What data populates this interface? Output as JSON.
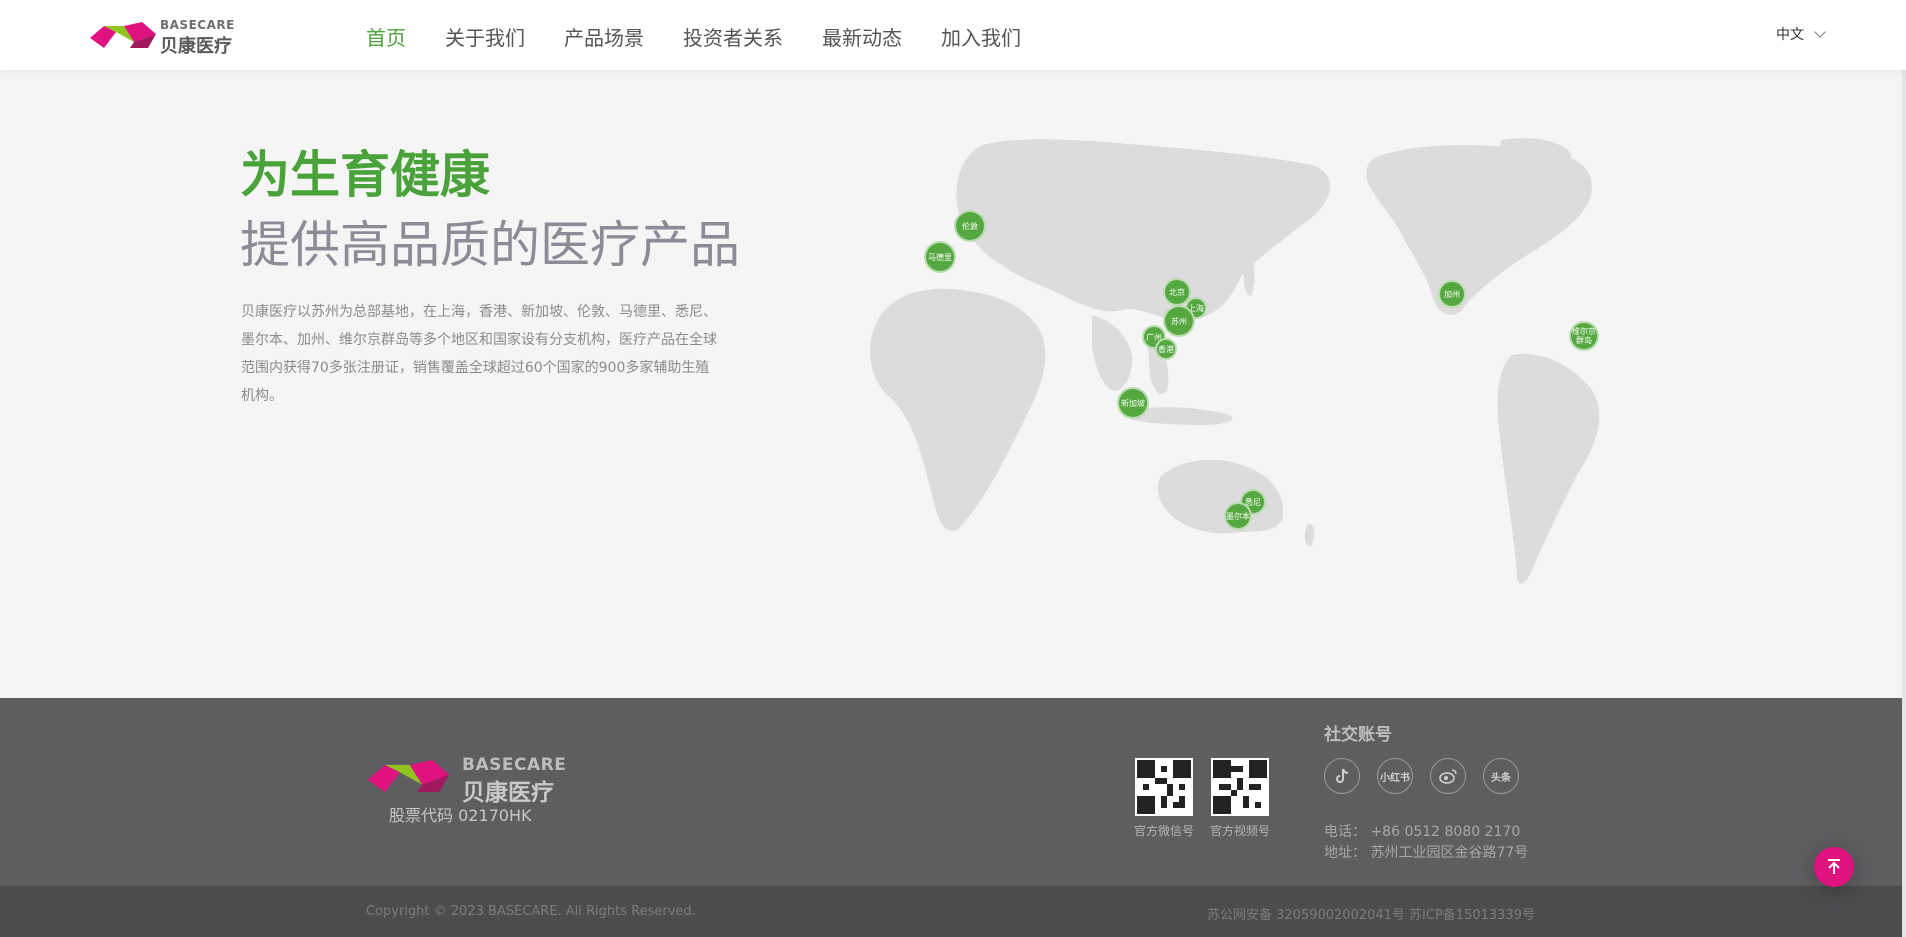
{
  "header": {
    "logo_en": "BASECARE",
    "logo_cn": "贝康医疗",
    "nav": [
      "首页",
      "关于我们",
      "产品场景",
      "投资者关系",
      "最新动态",
      "加入我们"
    ],
    "lang": "中文"
  },
  "hero": {
    "title1": "为生育健康",
    "title2": "提供高品质的医疗产品",
    "desc": "贝康医疗以苏州为总部基地，在上海，香港、新加坡、伦敦、马德里、悉尼、墨尔本、加州、维尔京群岛等多个地区和国家设有分支机构，医疗产品在全球范围内获得70多张注册证，销售覆盖全球超过60个国家的900多家辅助生殖机构。"
  },
  "map": {
    "cities": [
      "伦敦",
      "马德里",
      "北京",
      "上海",
      "苏州",
      "广州",
      "香港",
      "新加坡",
      "加州",
      "维尔京群岛",
      "悉尼",
      "墨尔本"
    ]
  },
  "footer": {
    "logo_en": "BASECARE",
    "logo_cn": "贝康医疗",
    "stock": "股票代码  02170HK",
    "qr1_label": "官方微信号",
    "qr2_label": "官方视频号",
    "social_title": "社交账号",
    "social": [
      "douyin-icon",
      "小红书",
      "weibo-icon",
      "头条"
    ],
    "phone": "电话：  +86 0512 8080 2170",
    "address": "地址：  苏州工业园区金谷路77号",
    "copyright": "Copyright © 2023 BASECARE. All Rights Reserved.",
    "icp": "苏公网安备 32059002002041号 苏ICP备15013339号"
  },
  "colors": {
    "brand_green": "#4aa23a",
    "brand_pink": "#e0127f",
    "footer_bg": "#5e5e61"
  }
}
